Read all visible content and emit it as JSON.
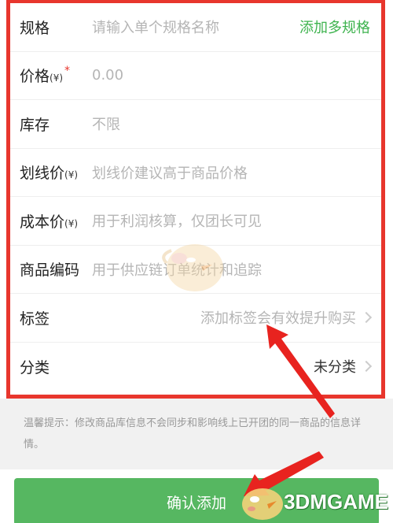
{
  "form": {
    "rows": [
      {
        "label": "规格",
        "unit": "",
        "value": "请输入单个规格名称",
        "action": "添加多规格"
      },
      {
        "label": "价格",
        "unit": "(¥)",
        "required": "*",
        "value": "0.00"
      },
      {
        "label": "库存",
        "unit": "",
        "value": "不限"
      },
      {
        "label": "划线价",
        "unit": "(¥)",
        "value": "划线价建议高于商品价格"
      },
      {
        "label": "成本价",
        "unit": "(¥)",
        "value": "用于利润核算，仅团长可见"
      },
      {
        "label": "商品编码",
        "unit": "",
        "value": "用于供应链订单统计和追踪"
      },
      {
        "label": "标签",
        "unit": "",
        "value": "添加标签会有效提升购买"
      },
      {
        "label": "分类",
        "unit": "",
        "value": "未分类"
      }
    ]
  },
  "tip": {
    "text": "温馨提示：修改商品库信息不会同步和影响线上已开团的同一商品的信息详情。"
  },
  "footer": {
    "confirm_label": "确认添加"
  },
  "watermark": {
    "text": "3DMGAME"
  },
  "colors": {
    "highlight_border": "#e8362d",
    "accent_green": "#3fb34f",
    "button_green": "#56b761",
    "placeholder": "#b5b5b5"
  },
  "icons": [
    "chevron-right-icon",
    "red-arrow-annotation",
    "mascot-watermark-icon"
  ]
}
